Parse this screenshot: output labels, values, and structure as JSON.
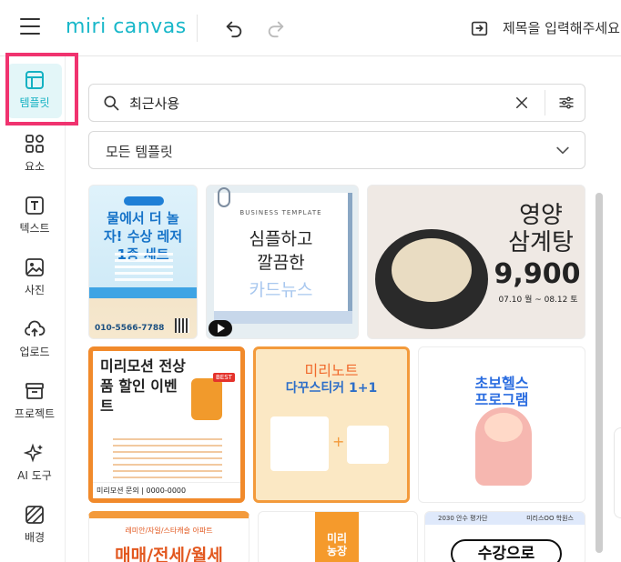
{
  "header": {
    "logo": "miri canvas",
    "doc_title": "제목을 입력해주세요."
  },
  "sidebar": {
    "items": [
      {
        "label": "템플릿",
        "icon": "template-icon",
        "active": true
      },
      {
        "label": "요소",
        "icon": "elements-icon"
      },
      {
        "label": "텍스트",
        "icon": "text-icon"
      },
      {
        "label": "사진",
        "icon": "photo-icon"
      },
      {
        "label": "업로드",
        "icon": "upload-icon"
      },
      {
        "label": "프로젝트",
        "icon": "project-icon"
      },
      {
        "label": "AI 도구",
        "icon": "ai-tools-icon"
      },
      {
        "label": "배경",
        "icon": "background-icon"
      }
    ]
  },
  "search": {
    "value": "최근사용"
  },
  "filter": {
    "selected": "모든 템플릿"
  },
  "templates": {
    "c1": {
      "title": "물에서 더 놀자! 수상 레저 1종 세트",
      "phone": "010-5566-7788"
    },
    "c2": {
      "subtitle": "BUSINESS TEMPLATE",
      "line1": "심플하고",
      "line2": "깔끔한",
      "line3": "카드뉴스"
    },
    "c3": {
      "title": "영양 삼계탕",
      "price": "9,900",
      "date": "07.10 월 ~ 08.12 토"
    },
    "c4": {
      "title": "미리모션 전상품 할인 이벤트",
      "badge": "BEST",
      "footer": "미리모션 문의 | 0000-0000"
    },
    "c5": {
      "title": "미리노트",
      "subtitle": "다꾸스티커 1+1"
    },
    "c6": {
      "title": "초보헬스",
      "subtitle": "프로그램"
    },
    "c7": {
      "small": "레미안/자일/스타캐슬 아파트",
      "title": "매매/전세/월세"
    },
    "c8": {
      "title": "미리 농장"
    },
    "c9": {
      "left": "2030 안수 평가단",
      "right": "미리스OO 학원스",
      "title": "수강으로"
    }
  },
  "colors": {
    "accent": "#14b1c2",
    "highlight": "#f0336f"
  }
}
